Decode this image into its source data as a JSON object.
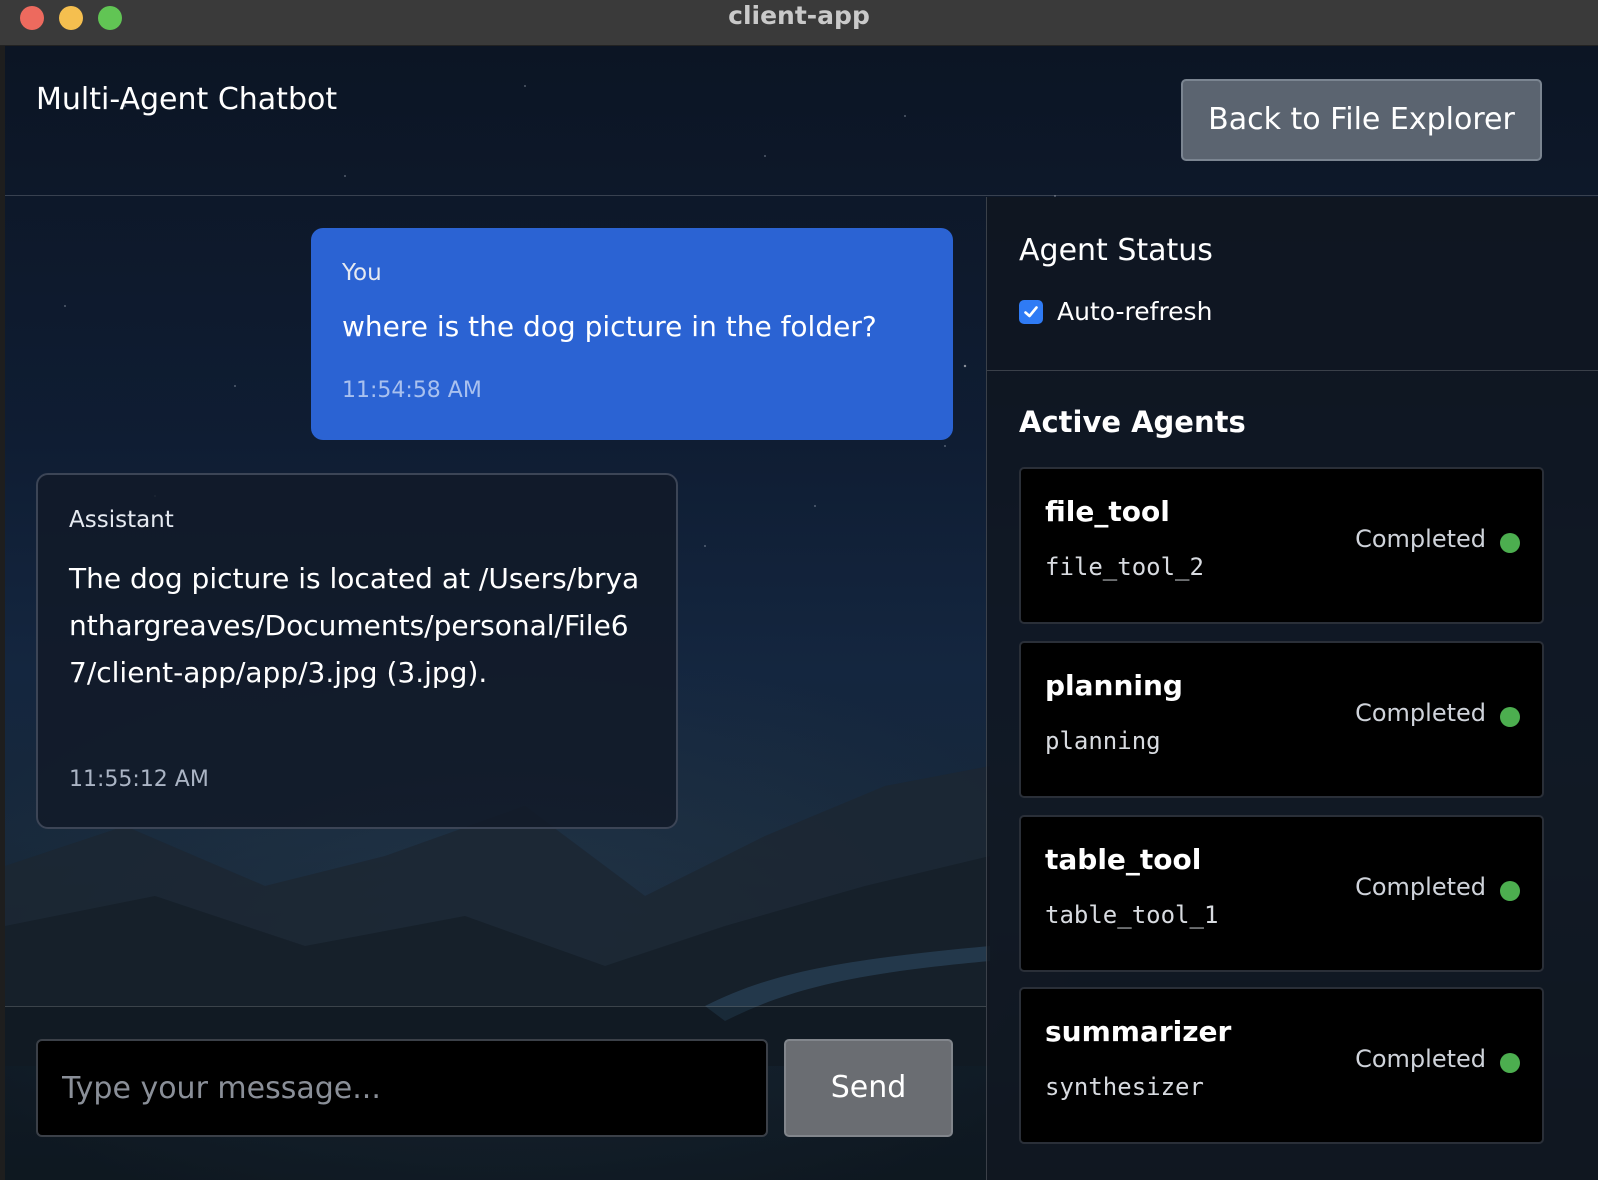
{
  "window": {
    "title": "client-app"
  },
  "header": {
    "title": "Multi-Agent Chatbot",
    "back_button": "Back to File Explorer"
  },
  "messages": [
    {
      "sender": "You",
      "text": "where is the dog picture in the folder?",
      "time": "11:54:58 AM"
    },
    {
      "sender": "Assistant",
      "text": "The dog picture is located at /Users/bryanthargreaves/Documents/personal/File67/client-app/app/3.jpg (3.jpg).",
      "time": "11:55:12 AM"
    }
  ],
  "composer": {
    "placeholder": "Type your message...",
    "value": "",
    "send_label": "Send"
  },
  "sidebar": {
    "status_title": "Agent Status",
    "auto_refresh": {
      "label": "Auto-refresh",
      "checked": true
    },
    "agents_title": "Active Agents",
    "agents": [
      {
        "name": "file_tool",
        "id": "file_tool_2",
        "status": "Completed",
        "status_color": "#4cae4f"
      },
      {
        "name": "planning",
        "id": "planning",
        "status": "Completed",
        "status_color": "#4cae4f"
      },
      {
        "name": "table_tool",
        "id": "table_tool_1",
        "status": "Completed",
        "status_color": "#4cae4f"
      },
      {
        "name": "summarizer",
        "id": "synthesizer",
        "status": "Completed",
        "status_color": "#4cae4f"
      }
    ]
  },
  "colors": {
    "user_bubble": "#2b63d3",
    "checkbox_accent": "#2f7bf5",
    "status_ok": "#4cae4f"
  }
}
